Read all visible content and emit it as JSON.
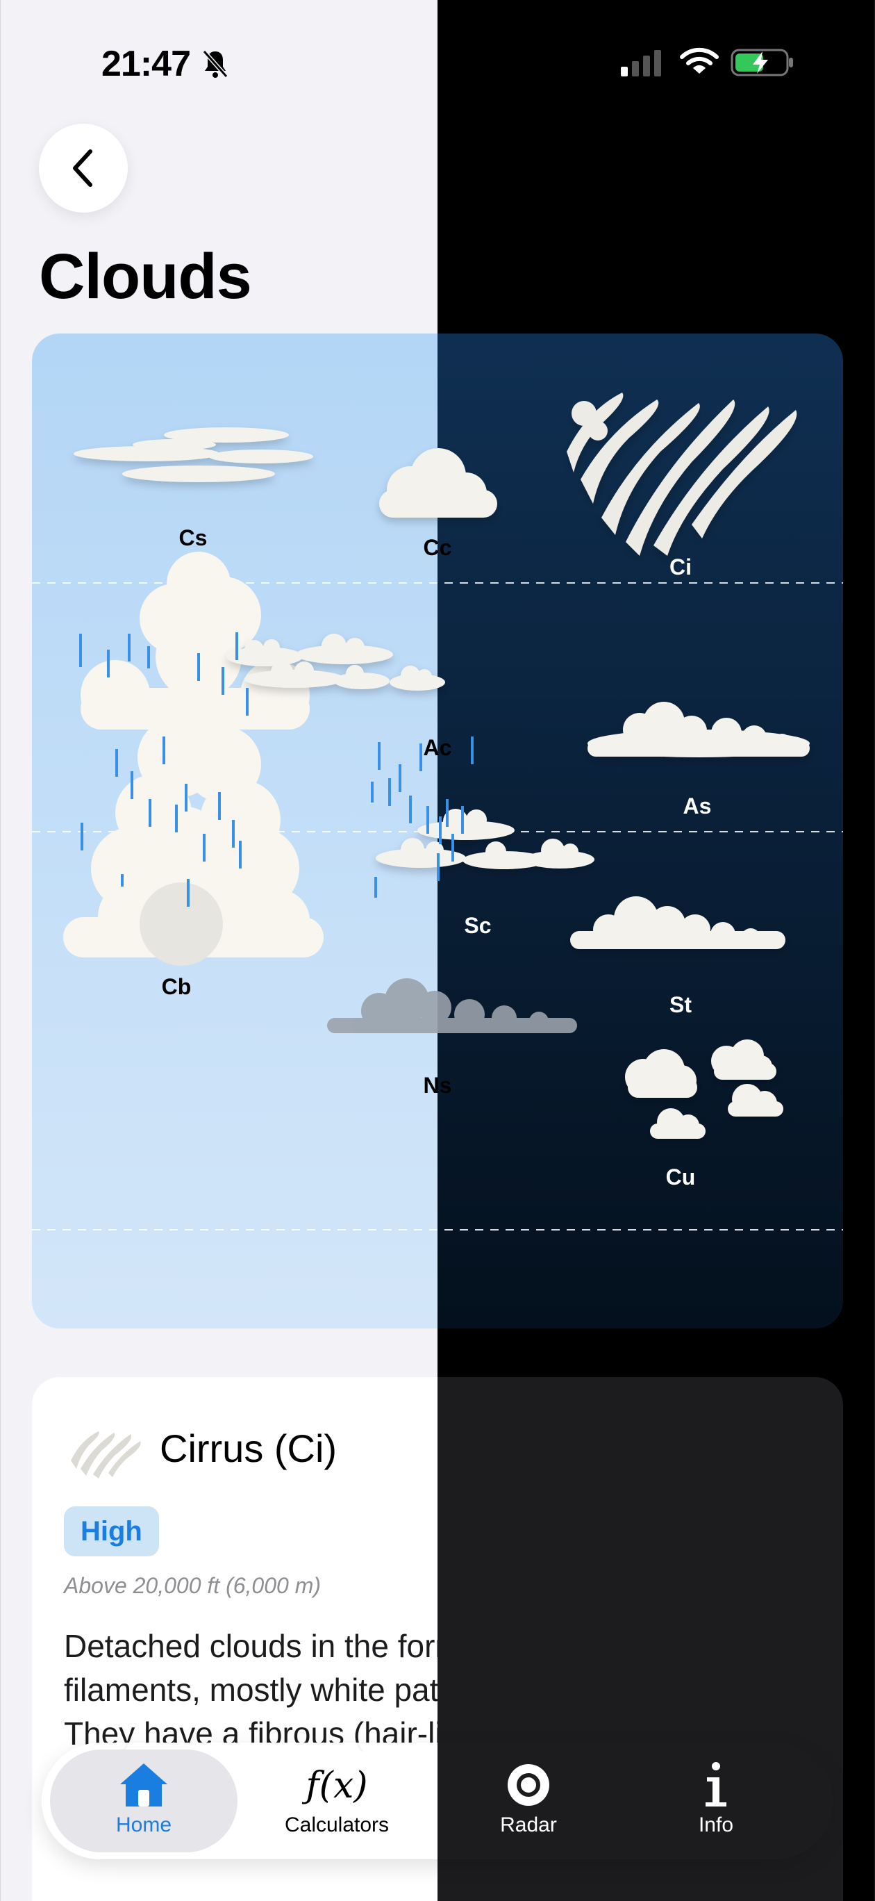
{
  "status_bar": {
    "time": "21:47",
    "icons": [
      "bell-slash-icon",
      "signal-icon",
      "wifi-icon",
      "battery-charging-icon"
    ]
  },
  "header": {
    "back_icon": "chevron-left-icon",
    "title": "Clouds"
  },
  "diagram": {
    "labels": {
      "cs": "Cs",
      "cc": "Cc",
      "ci": "Ci",
      "ac": "Ac",
      "as": "As",
      "sc": "Sc",
      "cb": "Cb",
      "st": "St",
      "ns": "Ns",
      "cu": "Cu"
    },
    "colors": {
      "sky_light": "#b6d8f6",
      "sky_dark": "#0d2a4b",
      "rain": "#3a8fe6",
      "cloud": "#f7f5f0"
    }
  },
  "detail": {
    "icon": "cirrus-cloud-icon",
    "title": "Cirrus (Ci)",
    "level_badge": "High",
    "altitude": "Above 20,000 ft (6,000 m)",
    "description_lines": [
      "Detached clouds in the form of white, delicate",
      "filaments, mostly white patches or narrow bands.",
      "They have a fibrous (hair-like) and/or silky sheen."
    ]
  },
  "tabbar": {
    "tabs": [
      {
        "label": "Home",
        "icon": "house-icon",
        "active": true
      },
      {
        "label": "Calculators",
        "icon": "function-icon",
        "active": false
      },
      {
        "label": "Radar",
        "icon": "radar-icon",
        "active": false
      },
      {
        "label": "Info",
        "icon": "info-icon",
        "active": false
      }
    ],
    "active_color": "#1a7ee0"
  }
}
